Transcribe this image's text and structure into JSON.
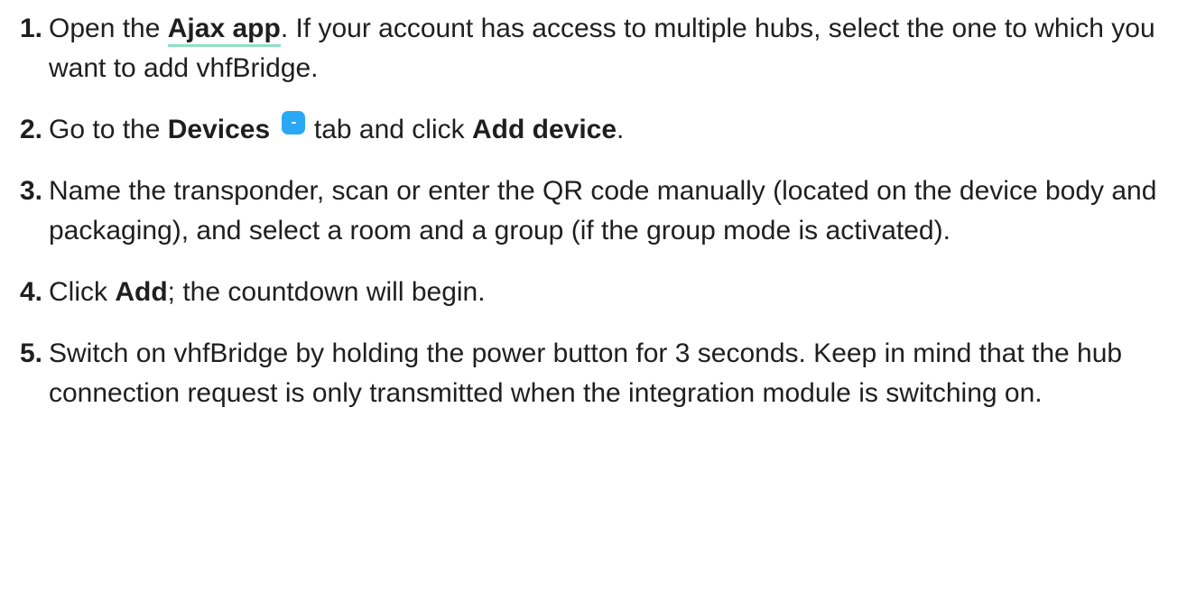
{
  "steps": [
    {
      "num": "1.",
      "text_before": "Open the ",
      "link": "Ajax app",
      "text_after": ". If your account has access to multiple hubs, select the one to which you want to add vhfBridge."
    },
    {
      "num": "2.",
      "text_before": "Go to the ",
      "bold1": "Devices",
      "icon": "devices-tab-icon",
      "text_middle": " tab and click ",
      "bold2": "Add device",
      "text_after": "."
    },
    {
      "num": "3.",
      "text": "Name the transponder, scan or enter the QR code manually (located on the device body and packaging), and select a room and a group (if the group mode is activated)."
    },
    {
      "num": "4.",
      "text_before": "Click ",
      "bold": "Add",
      "text_after": "; the countdown will begin."
    },
    {
      "num": "5.",
      "text": "Switch on vhfBridge by holding the power button for 3 seconds. Keep in mind that the hub connection request is only transmitted when the integration module is switching on."
    }
  ],
  "colors": {
    "text": "#1f1f1f",
    "link_underline": "#8fe0c3",
    "icon_bg": "#29a8f4"
  }
}
